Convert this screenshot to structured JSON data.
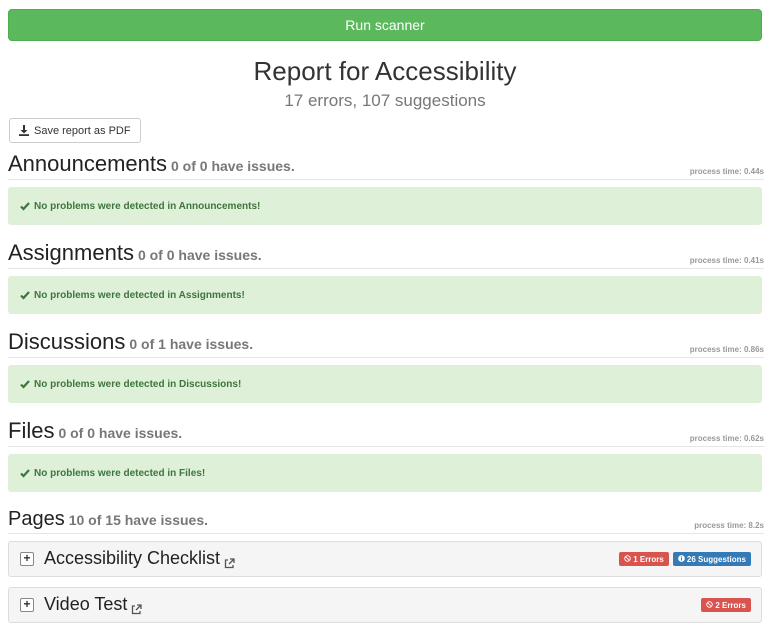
{
  "toolbar": {
    "run_label": "Run scanner",
    "pdf_label": "Save report as PDF"
  },
  "report": {
    "title": "Report for Accessibility",
    "summary": "17 errors, 107 suggestions"
  },
  "sections": [
    {
      "name": "Announcements",
      "count": "0 of 0 have issues.",
      "process_time": "process time: 0.44s",
      "message": "No problems were detected in Announcements!"
    },
    {
      "name": "Assignments",
      "count": "0 of 0 have issues.",
      "process_time": "process time: 0.41s",
      "message": "No problems were detected in Assignments!"
    },
    {
      "name": "Discussions",
      "count": "0 of 1 have issues.",
      "process_time": "process time: 0.86s",
      "message": "No problems were detected in Discussions!"
    },
    {
      "name": "Files",
      "count": "0 of 0 have issues.",
      "process_time": "process time: 0.62s",
      "message": "No problems were detected in Files!"
    },
    {
      "name": "Pages",
      "count": "10 of 15 have issues.",
      "process_time": "process time: 8.2s"
    }
  ],
  "pages": [
    {
      "title": "Accessibility Checklist",
      "errors_badge": "1 Errors",
      "suggestions_badge": "26 Suggestions"
    },
    {
      "title": "Video Test",
      "errors_badge": "2 Errors"
    }
  ],
  "icons": {
    "download": "download-icon",
    "check": "check-icon",
    "external": "external-link-icon",
    "plus": "plus-icon",
    "ban": "ban-icon",
    "info": "info-icon"
  },
  "colors": {
    "run_button": "#5cb85c",
    "success_bg": "#dff0d8",
    "success_text": "#3c763d",
    "error_badge": "#d9534f",
    "suggestion_badge": "#337ab7"
  }
}
